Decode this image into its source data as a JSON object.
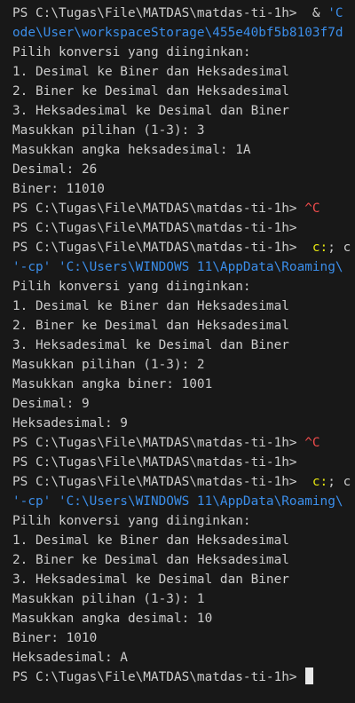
{
  "terminal": {
    "lines": [
      {
        "segments": [
          {
            "text": "PS C:\\Tugas\\File\\MATDAS\\matdas-ti-1h> ",
            "style": "default"
          },
          {
            "text": " & ",
            "style": "default"
          },
          {
            "text": "'C",
            "style": "string"
          }
        ]
      },
      {
        "segments": [
          {
            "text": "ode\\User\\workspaceStorage\\455e40bf5b8103f7d",
            "style": "string"
          }
        ]
      },
      {
        "segments": [
          {
            "text": "Pilih konversi yang diinginkan:",
            "style": "default"
          }
        ]
      },
      {
        "segments": [
          {
            "text": "1. Desimal ke Biner dan Heksadesimal",
            "style": "default"
          }
        ]
      },
      {
        "segments": [
          {
            "text": "2. Biner ke Desimal dan Heksadesimal",
            "style": "default"
          }
        ]
      },
      {
        "segments": [
          {
            "text": "3. Heksadesimal ke Desimal dan Biner",
            "style": "default"
          }
        ]
      },
      {
        "segments": [
          {
            "text": "Masukkan pilihan (1-3): 3",
            "style": "default"
          }
        ]
      },
      {
        "segments": [
          {
            "text": "Masukkan angka heksadesimal: 1A",
            "style": "default"
          }
        ]
      },
      {
        "segments": [
          {
            "text": "Desimal: 26",
            "style": "default"
          }
        ]
      },
      {
        "segments": [
          {
            "text": "Biner: 11010",
            "style": "default"
          }
        ]
      },
      {
        "segments": [
          {
            "text": "PS C:\\Tugas\\File\\MATDAS\\matdas-ti-1h> ",
            "style": "default"
          },
          {
            "text": "^C",
            "style": "red"
          }
        ]
      },
      {
        "segments": [
          {
            "text": "PS C:\\Tugas\\File\\MATDAS\\matdas-ti-1h>",
            "style": "default"
          }
        ]
      },
      {
        "segments": [
          {
            "text": "PS C:\\Tugas\\File\\MATDAS\\matdas-ti-1h> ",
            "style": "default"
          },
          {
            "text": " c:",
            "style": "yellow"
          },
          {
            "text": ";",
            "style": "default"
          },
          {
            "text": " c",
            "style": "default"
          }
        ]
      },
      {
        "segments": [
          {
            "text": "'-cp' 'C:\\Users\\WINDOWS 11\\AppData\\Roaming\\",
            "style": "string"
          }
        ]
      },
      {
        "segments": [
          {
            "text": "Pilih konversi yang diinginkan:",
            "style": "default"
          }
        ]
      },
      {
        "segments": [
          {
            "text": "1. Desimal ke Biner dan Heksadesimal",
            "style": "default"
          }
        ]
      },
      {
        "segments": [
          {
            "text": "2. Biner ke Desimal dan Heksadesimal",
            "style": "default"
          }
        ]
      },
      {
        "segments": [
          {
            "text": "3. Heksadesimal ke Desimal dan Biner",
            "style": "default"
          }
        ]
      },
      {
        "segments": [
          {
            "text": "Masukkan pilihan (1-3): 2",
            "style": "default"
          }
        ]
      },
      {
        "segments": [
          {
            "text": "Masukkan angka biner: 1001",
            "style": "default"
          }
        ]
      },
      {
        "segments": [
          {
            "text": "Desimal: 9",
            "style": "default"
          }
        ]
      },
      {
        "segments": [
          {
            "text": "Heksadesimal: 9",
            "style": "default"
          }
        ]
      },
      {
        "segments": [
          {
            "text": "PS C:\\Tugas\\File\\MATDAS\\matdas-ti-1h> ",
            "style": "default"
          },
          {
            "text": "^C",
            "style": "red"
          }
        ]
      },
      {
        "segments": [
          {
            "text": "PS C:\\Tugas\\File\\MATDAS\\matdas-ti-1h>",
            "style": "default"
          }
        ]
      },
      {
        "segments": [
          {
            "text": "PS C:\\Tugas\\File\\MATDAS\\matdas-ti-1h> ",
            "style": "default"
          },
          {
            "text": " c:",
            "style": "yellow"
          },
          {
            "text": ";",
            "style": "default"
          },
          {
            "text": " c",
            "style": "default"
          }
        ]
      },
      {
        "segments": [
          {
            "text": "'-cp' 'C:\\Users\\WINDOWS 11\\AppData\\Roaming\\",
            "style": "string"
          }
        ]
      },
      {
        "segments": [
          {
            "text": "Pilih konversi yang diinginkan:",
            "style": "default"
          }
        ]
      },
      {
        "segments": [
          {
            "text": "1. Desimal ke Biner dan Heksadesimal",
            "style": "default"
          }
        ]
      },
      {
        "segments": [
          {
            "text": "2. Biner ke Desimal dan Heksadesimal",
            "style": "default"
          }
        ]
      },
      {
        "segments": [
          {
            "text": "3. Heksadesimal ke Desimal dan Biner",
            "style": "default"
          }
        ]
      },
      {
        "segments": [
          {
            "text": "Masukkan pilihan (1-3): 1",
            "style": "default"
          }
        ]
      },
      {
        "segments": [
          {
            "text": "Masukkan angka desimal: 10",
            "style": "default"
          }
        ]
      },
      {
        "segments": [
          {
            "text": "Biner: 1010",
            "style": "default"
          }
        ]
      },
      {
        "segments": [
          {
            "text": "Heksadesimal: A",
            "style": "default"
          }
        ]
      }
    ],
    "prompt": {
      "text": "PS C:\\Tugas\\File\\MATDAS\\matdas-ti-1h> "
    }
  },
  "colors": {
    "background": "#181818",
    "text": "#cccccc",
    "string": "#3b8eea",
    "highlight_yellow": "#e5e510",
    "interrupt_red": "#f14c4c",
    "cursor": "#e8e8e8"
  }
}
